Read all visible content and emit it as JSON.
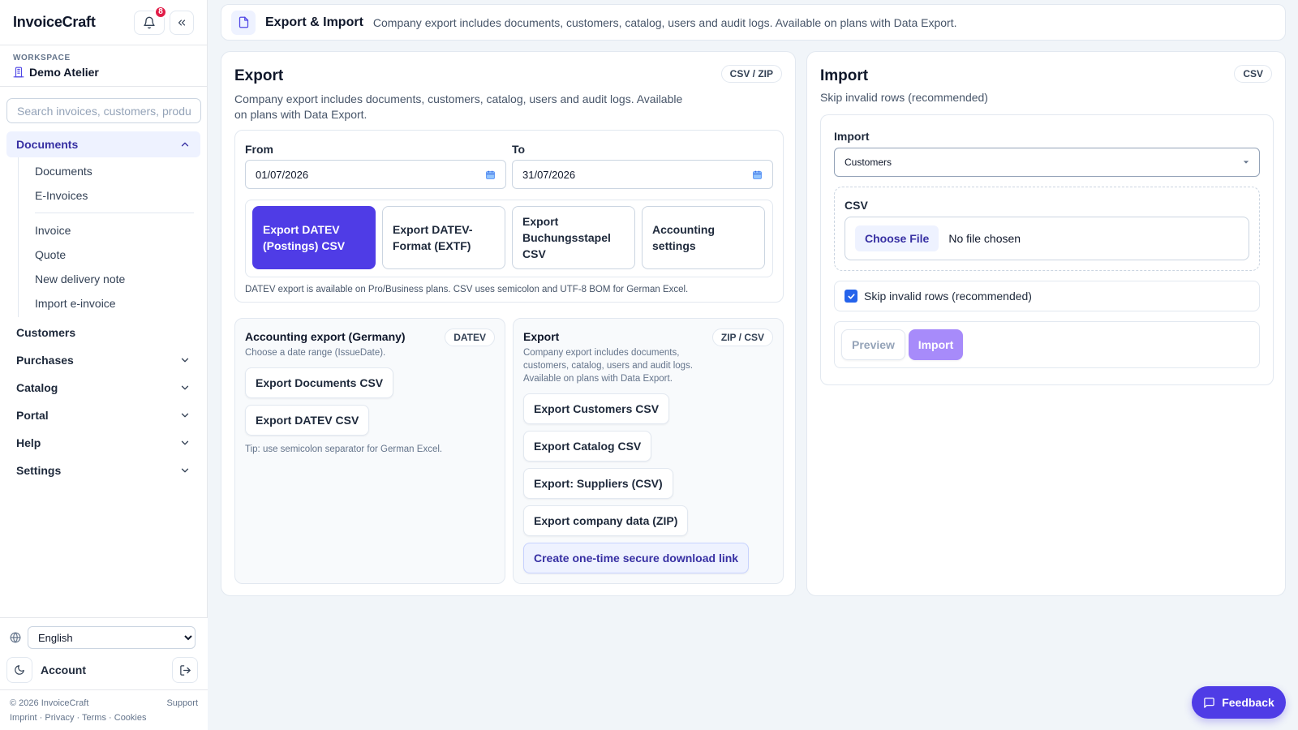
{
  "app": {
    "brand": "InvoiceCraft",
    "notification_count": "8"
  },
  "workspace": {
    "label": "WORKSPACE",
    "name": "Demo Atelier"
  },
  "search": {
    "placeholder": "Search invoices, customers, products"
  },
  "nav": {
    "active_group": "Documents",
    "sub_items_a": [
      "Documents",
      "E-Invoices"
    ],
    "sub_items_b": [
      "Invoice",
      "Quote",
      "New delivery note",
      "Import e-invoice"
    ],
    "customers": "Customers",
    "purchases": "Purchases",
    "catalog": "Catalog",
    "portal": "Portal",
    "help": "Help",
    "settings": "Settings"
  },
  "sidebar_bottom": {
    "language": "English",
    "account": "Account",
    "copyright": "© 2026 InvoiceCraft",
    "support": "Support",
    "links": "Imprint · Privacy · Terms · Cookies"
  },
  "topbar": {
    "title": "Export & Import",
    "subtitle": "Company export includes documents, customers, catalog, users and audit logs. Available on plans with Data Export."
  },
  "export": {
    "title": "Export",
    "badge": "CSV / ZIP",
    "description": "Company export includes documents, customers, catalog, users and audit logs. Available on plans with Data Export.",
    "from_label": "From",
    "from_value": "01/07/2026",
    "to_label": "To",
    "to_value": "31/07/2026",
    "tiles": [
      "Export DATEV (Postings) CSV",
      "Export DATEV-Format (EXTF)",
      "Export Buchungsstapel CSV",
      "Accounting settings"
    ],
    "datev_note": "DATEV export is available on Pro/Business plans. CSV uses semicolon and UTF-8 BOM for German Excel.",
    "accounting": {
      "title": "Accounting export (Germany)",
      "badge": "DATEV",
      "description": "Choose a date range (IssueDate).",
      "buttons": [
        "Export Documents CSV",
        "Export DATEV CSV"
      ],
      "tip": "Tip: use semicolon separator for German Excel."
    },
    "company": {
      "title": "Export",
      "badge": "ZIP / CSV",
      "description": "Company export includes documents, customers, catalog, users and audit logs. Available on plans with Data Export.",
      "buttons": [
        "Export Customers CSV",
        "Export Catalog CSV",
        "Export: Suppliers (CSV)",
        "Export company data (ZIP)"
      ],
      "secure_link": "Create one-time secure download link"
    }
  },
  "import": {
    "title": "Import",
    "badge": "CSV",
    "description": "Skip invalid rows (recommended)",
    "type_label": "Import",
    "type_value": "Customers",
    "csv_label": "CSV",
    "choose_file": "Choose File",
    "no_file": "No file chosen",
    "skip_label": "Skip invalid rows (recommended)",
    "skip_checked": true,
    "preview": "Preview",
    "import_button": "Import"
  },
  "feedback": {
    "label": "Feedback"
  },
  "colors": {
    "primary": "#4f3ce6",
    "accent_light": "#eef2ff",
    "badge_red": "#e11d48"
  }
}
